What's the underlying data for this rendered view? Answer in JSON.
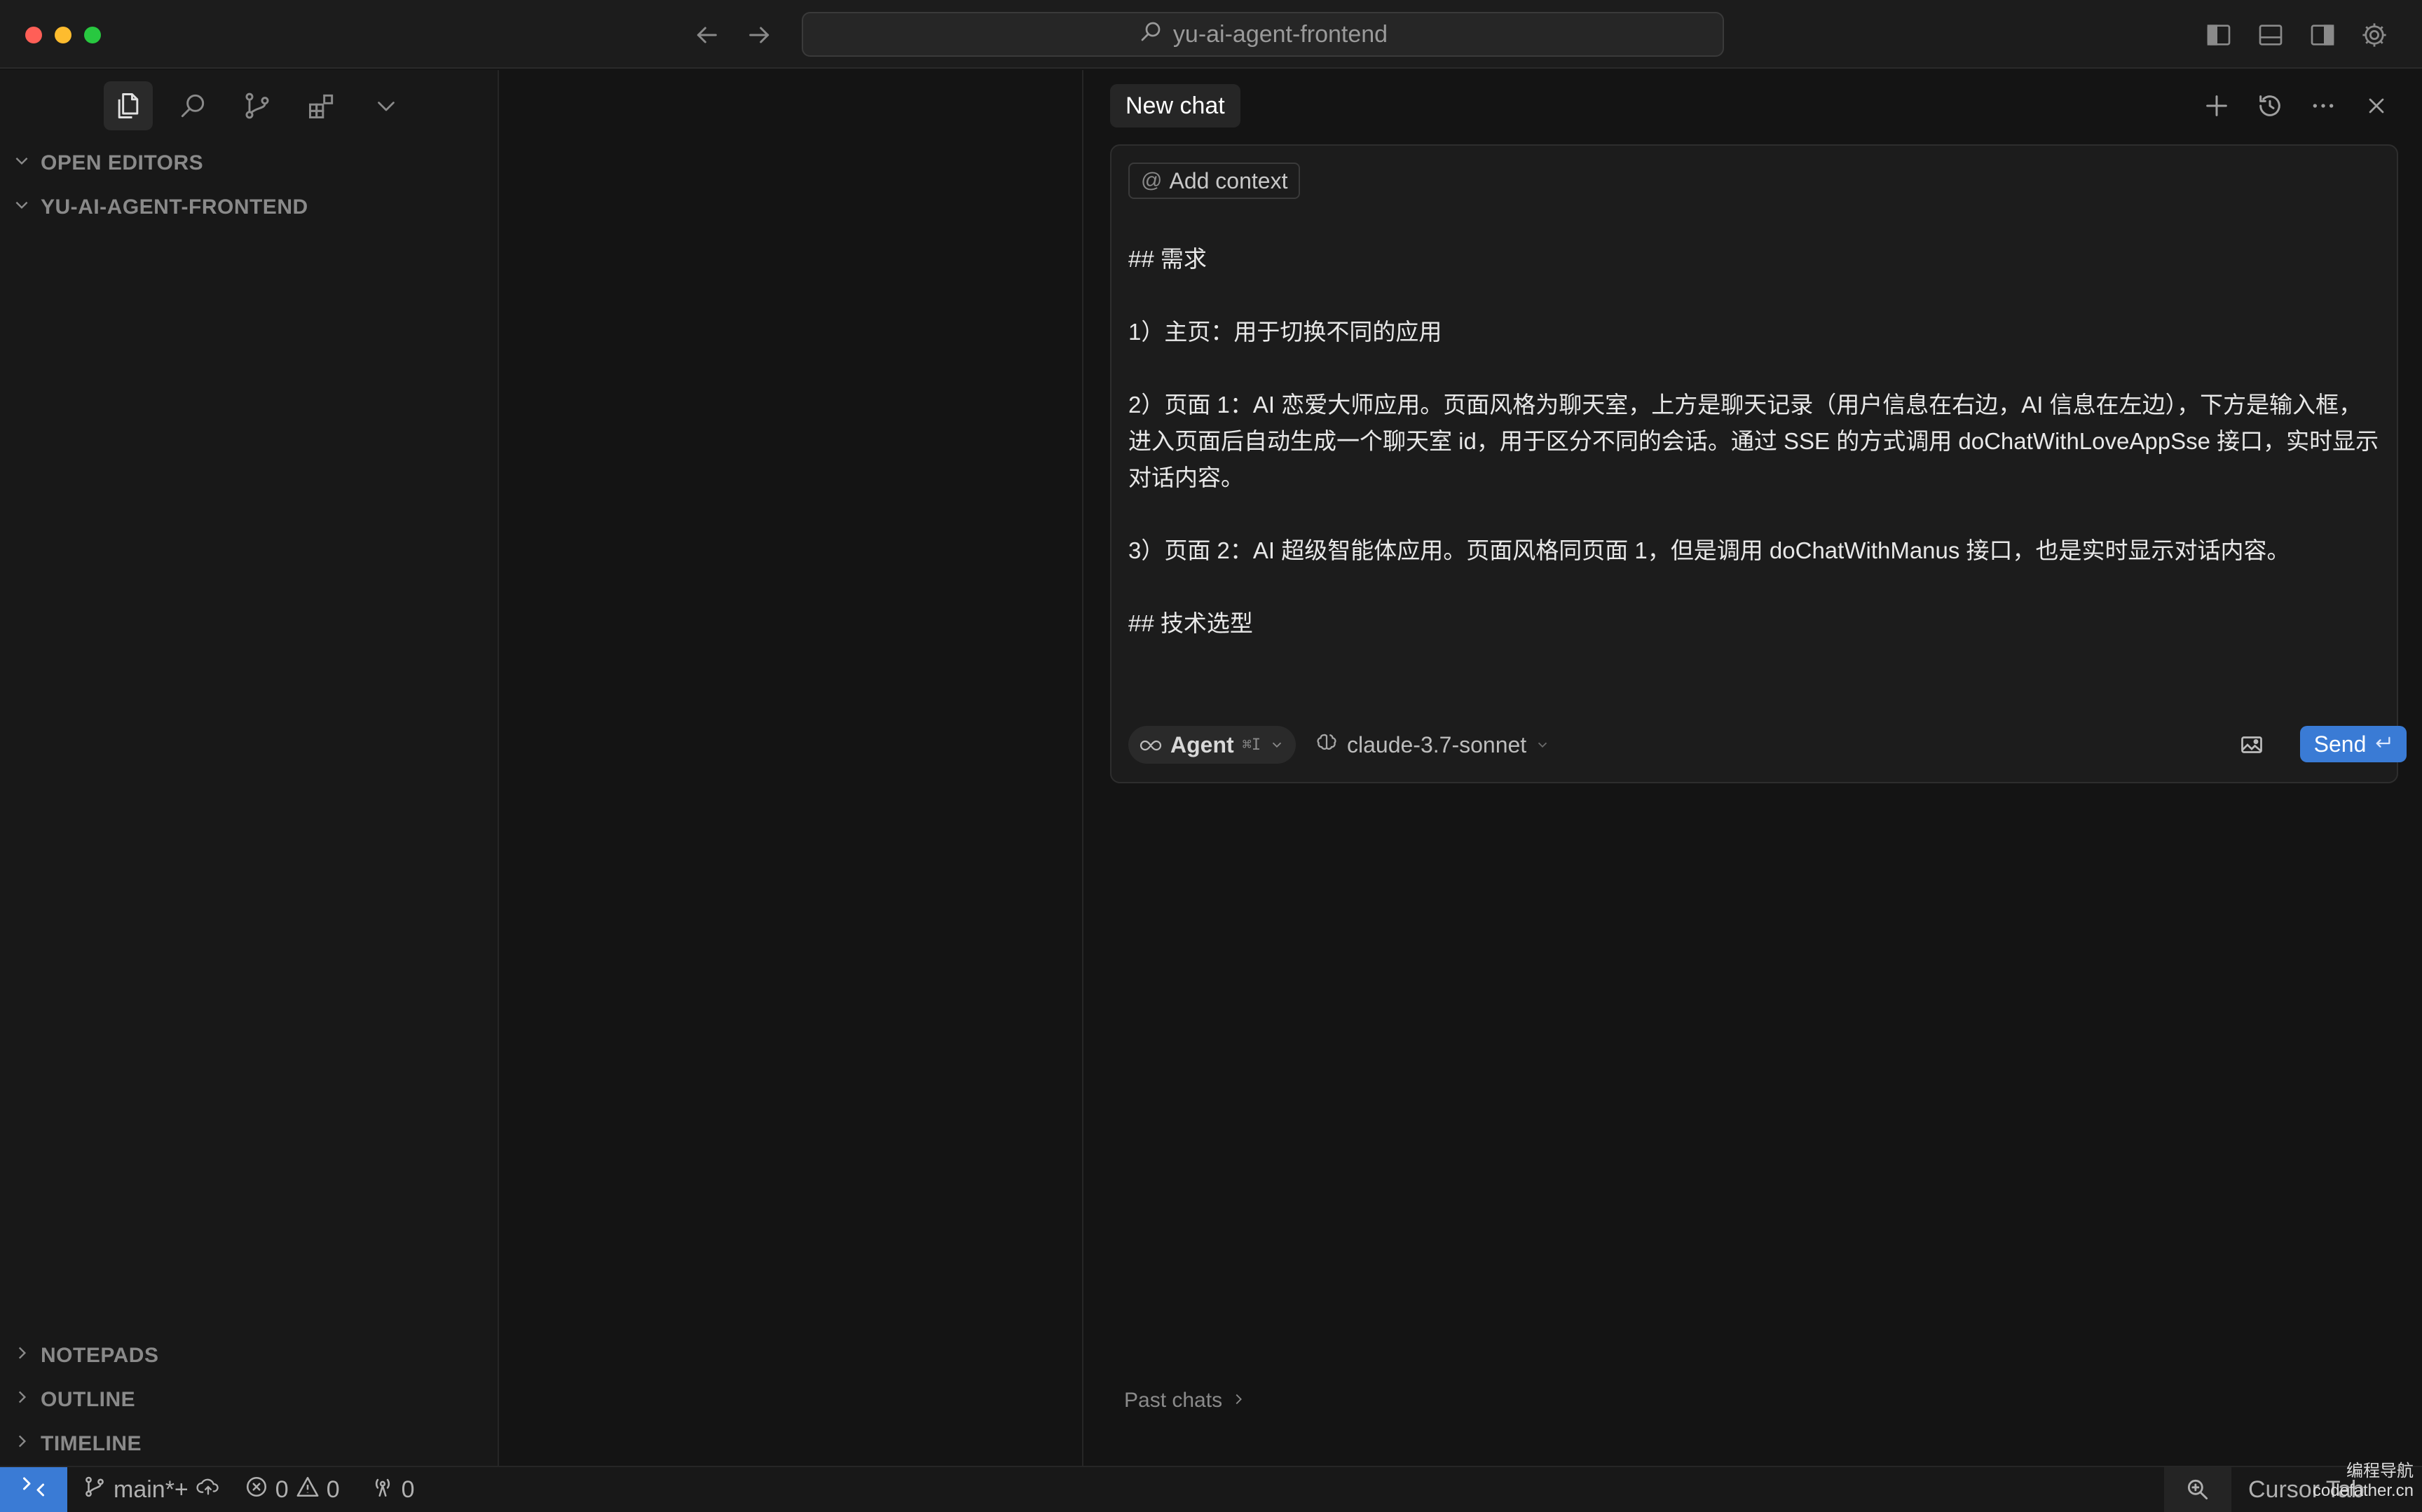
{
  "titlebar": {
    "search_text": "yu-ai-agent-frontend"
  },
  "sidebar": {
    "sections": {
      "open_editors": "OPEN EDITORS",
      "project": "YU-AI-AGENT-FRONTEND",
      "notepads": "NOTEPADS",
      "outline": "OUTLINE",
      "timeline": "TIMELINE"
    }
  },
  "chat": {
    "tab_label": "New chat",
    "add_context_label": "Add context",
    "prompt_lines": [
      "## 需求",
      "",
      "1）主页：用于切换不同的应用",
      "",
      "2）页面 1：AI 恋爱大师应用。页面风格为聊天室，上方是聊天记录（用户信息在右边，AI 信息在左边），下方是输入框，进入页面后自动生成一个聊天室 id，用于区分不同的会话。通过 SSE 的方式调用 doChatWithLoveAppSse 接口，实时显示对话内容。",
      "",
      "3）页面 2：AI 超级智能体应用。页面风格同页面 1，但是调用 doChatWithManus 接口，也是实时显示对话内容。",
      "",
      "## 技术选型"
    ],
    "mode_label": "Agent",
    "mode_shortcut": "⌘I",
    "model_label": "claude-3.7-sonnet",
    "send_label": "Send",
    "past_chats_label": "Past chats"
  },
  "statusbar": {
    "branch": "main*+",
    "errors": "0",
    "warnings": "0",
    "ports": "0",
    "cursor_tab": "Cursor Tab"
  },
  "watermark": {
    "line1": "编程导航",
    "line2": "codefather.cn"
  },
  "colors": {
    "accent": "#3a7bd5",
    "close": "#ff5f57",
    "minimize": "#febc2e",
    "maximize": "#28c840"
  }
}
